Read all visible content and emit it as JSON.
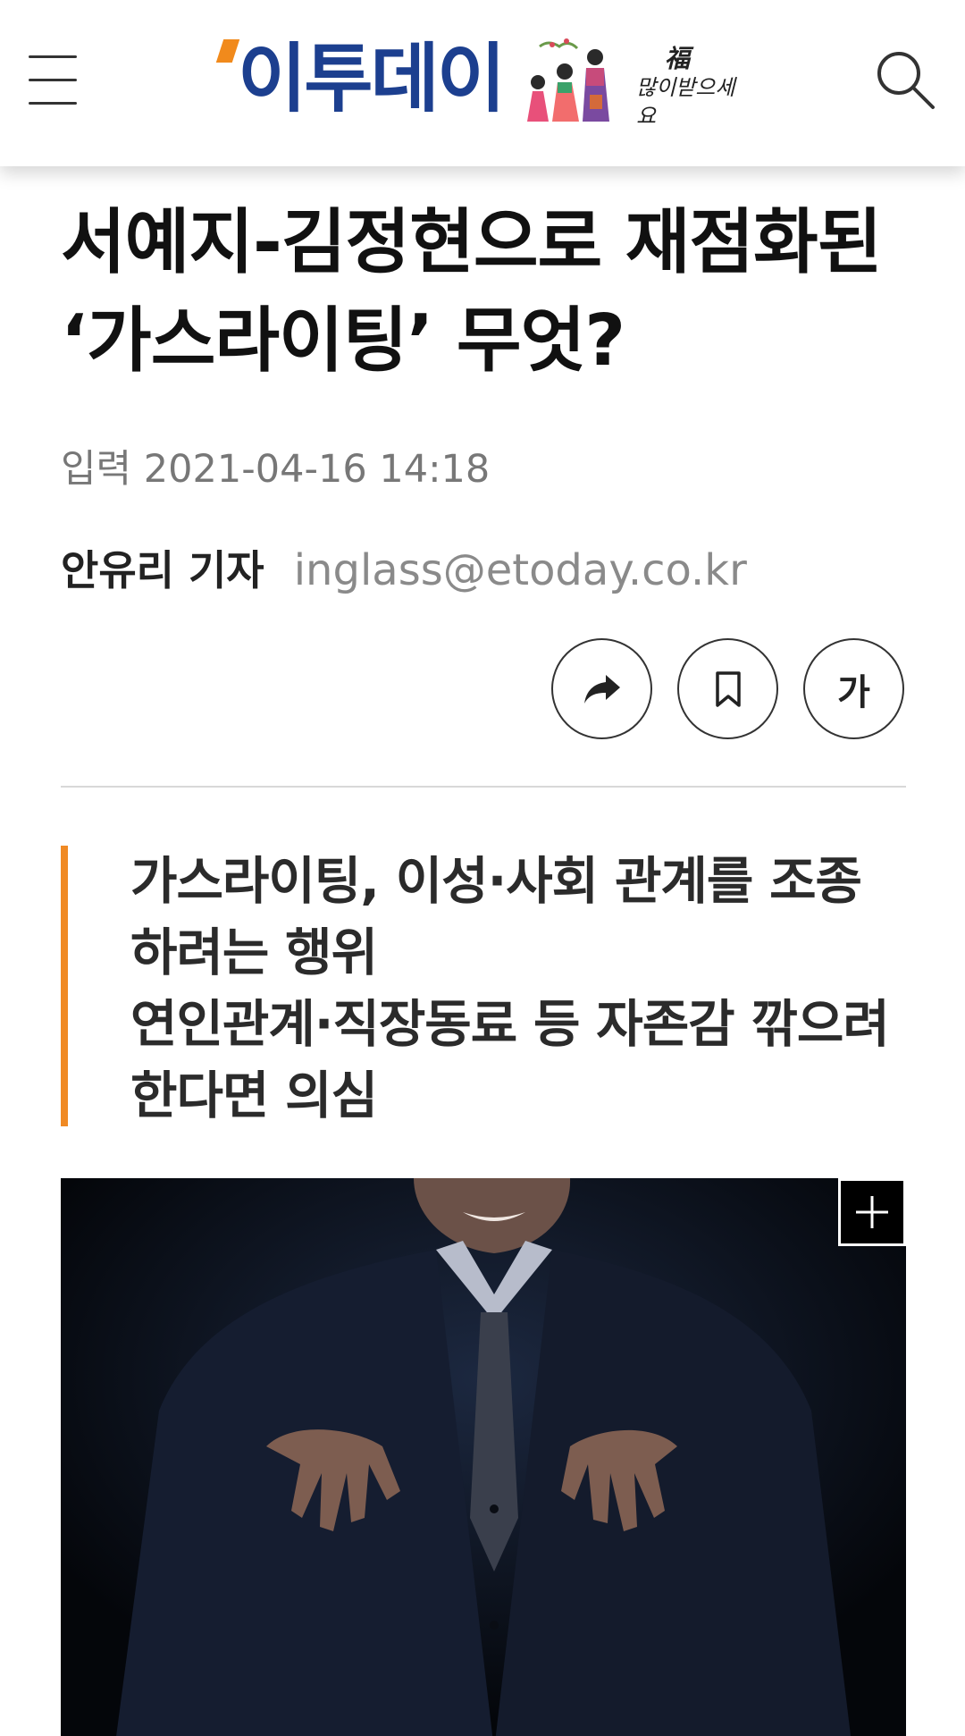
{
  "header": {
    "logo_text": "이투데이",
    "logo_slogan_top": "福",
    "logo_slogan_bottom": "많이받으세요",
    "brand_color": "#1c3f8f",
    "accent_color": "#f18a1c",
    "menu_icon": "hamburger-icon",
    "search_icon": "search-icon"
  },
  "article": {
    "title": "서예지-김정현으로 재점화된 ‘가스라이팅’ 무엇?",
    "date": "입력 2021-04-16 14:18",
    "reporter": "안유리 기자",
    "email": "inglass@etoday.co.kr",
    "actions": {
      "share_icon": "share-icon",
      "bookmark_icon": "bookmark-icon",
      "font_size_label": "가"
    },
    "subhead_lines": [
      "가스라이팅, 이성·사회 관계를 조종하려는 행위",
      "연인관계·직장동료 등 자존감 깎으려 한다면 의심"
    ],
    "photo_expand_icon": "plus-icon"
  }
}
